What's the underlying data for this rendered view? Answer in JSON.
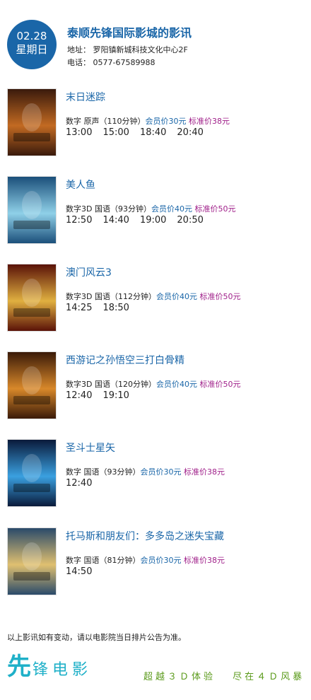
{
  "header": {
    "date": "02.28",
    "weekday": "星期日",
    "cinema_name": "泰顺先锋国际影城的影讯",
    "address": "地址：  罗阳镇新城科技文化中心2F",
    "phone": "电话：  0577-67589988"
  },
  "movies": [
    {
      "title": "末日迷踪",
      "format": "数字  原声（110分钟）",
      "member_price": "会员价30元",
      "standard_price": "标准价38元",
      "times": [
        "13:00",
        "15:00",
        "18:40",
        "20:40"
      ],
      "poster_colors": [
        "#3a1a0c",
        "#c26a22"
      ]
    },
    {
      "title": "美人鱼",
      "format": "数字3D  国语（93分钟）",
      "member_price": "会员价40元",
      "standard_price": "标准价50元",
      "times": [
        "12:50",
        "14:40",
        "19:00",
        "20:50"
      ],
      "poster_colors": [
        "#1b4f7a",
        "#8fd0e8"
      ]
    },
    {
      "title": "澳门风云3",
      "format": "数字3D  国语（112分钟）",
      "member_price": "会员价40元",
      "standard_price": "标准价50元",
      "times": [
        "14:25",
        "18:50"
      ],
      "poster_colors": [
        "#5a1208",
        "#e0b040"
      ]
    },
    {
      "title": "西游记之孙悟空三打白骨精",
      "format": "数字3D  国语（120分钟）",
      "member_price": "会员价40元",
      "standard_price": "标准价50元",
      "times": [
        "12:40",
        "19:10"
      ],
      "poster_colors": [
        "#3a1a08",
        "#d8882a"
      ]
    },
    {
      "title": "圣斗士星矢",
      "format": "数字  国语（93分钟）",
      "member_price": "会员价30元",
      "standard_price": "标准价38元",
      "times": [
        "12:40"
      ],
      "poster_colors": [
        "#0a1a3a",
        "#3aa0e0"
      ]
    },
    {
      "title": "托马斯和朋友们：多多岛之迷失宝藏",
      "format": "数字  国语（81分钟）",
      "member_price": "会员价30元",
      "standard_price": "标准价38元",
      "times": [
        "14:50"
      ],
      "poster_colors": [
        "#2a4a6a",
        "#e0c070"
      ]
    }
  ],
  "footer": {
    "notice": "以上影讯如有变动，请以电影院当日排片公告为准。",
    "brand_first": "先",
    "brand_rest": "锋电影",
    "slogan_1": "超越３Ｄ体验",
    "slogan_2": "尽在４Ｄ风暴"
  }
}
